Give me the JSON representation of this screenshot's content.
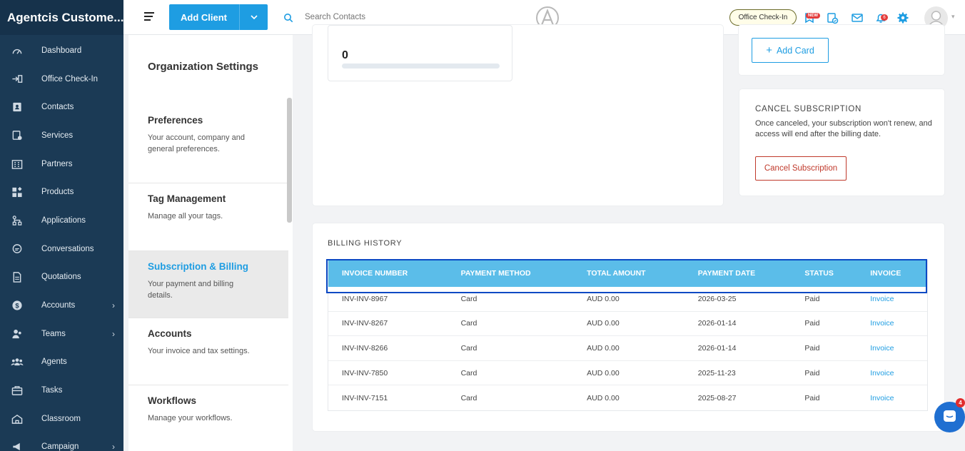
{
  "app": {
    "title": "Agentcis Custome..."
  },
  "sidebar": {
    "items": [
      {
        "label": "Dashboard",
        "icon": "speedometer-icon",
        "arrow": false
      },
      {
        "label": "Office Check-In",
        "icon": "checkin-icon",
        "arrow": false
      },
      {
        "label": "Contacts",
        "icon": "contacts-icon",
        "arrow": false
      },
      {
        "label": "Services",
        "icon": "services-icon",
        "arrow": false
      },
      {
        "label": "Partners",
        "icon": "building-icon",
        "arrow": false
      },
      {
        "label": "Products",
        "icon": "products-icon",
        "arrow": false
      },
      {
        "label": "Applications",
        "icon": "applications-icon",
        "arrow": false
      },
      {
        "label": "Conversations",
        "icon": "chat-icon",
        "arrow": false
      },
      {
        "label": "Quotations",
        "icon": "document-icon",
        "arrow": false
      },
      {
        "label": "Accounts",
        "icon": "dollar-icon",
        "arrow": true
      },
      {
        "label": "Teams",
        "icon": "team-icon",
        "arrow": true
      },
      {
        "label": "Agents",
        "icon": "agents-icon",
        "arrow": false
      },
      {
        "label": "Tasks",
        "icon": "briefcase-icon",
        "arrow": false
      },
      {
        "label": "Classroom",
        "icon": "classroom-icon",
        "arrow": false
      },
      {
        "label": "Campaign",
        "icon": "megaphone-icon",
        "arrow": true
      }
    ]
  },
  "topbar": {
    "add_client_label": "Add Client",
    "search_placeholder": "Search Contacts",
    "office_checkin_label": "Office Check-In",
    "new_badge": "NEW",
    "notification_count": "6"
  },
  "settings": {
    "title": "Organization Settings",
    "items": [
      {
        "title": "Preferences",
        "desc": "Your account, company and general preferences."
      },
      {
        "title": "Tag Management",
        "desc": "Manage all your tags."
      },
      {
        "title": "Subscription & Billing",
        "desc": "Your payment and billing details."
      },
      {
        "title": "Accounts",
        "desc": "Your invoice and tax settings."
      },
      {
        "title": "Workflows",
        "desc": "Manage your workflows."
      }
    ]
  },
  "license_card": {
    "value": "0"
  },
  "payment_card": {
    "add_card_label": "Add Card"
  },
  "cancel_card": {
    "title": "CANCEL SUBSCRIPTION",
    "description": "Once canceled, your subscription won't renew, and access will end after the billing date.",
    "button_label": "Cancel Subscription"
  },
  "billing": {
    "title": "BILLING HISTORY",
    "columns": [
      "INVOICE NUMBER",
      "PAYMENT METHOD",
      "TOTAL AMOUNT",
      "PAYMENT DATE",
      "STATUS",
      "INVOICE"
    ],
    "rows": [
      {
        "number": "INV-INV-8967",
        "method": "Card",
        "amount": "AUD 0.00",
        "date": "2026-03-25",
        "status": "Paid",
        "invoice": "Invoice"
      },
      {
        "number": "INV-INV-8267",
        "method": "Card",
        "amount": "AUD 0.00",
        "date": "2026-01-14",
        "status": "Paid",
        "invoice": "Invoice"
      },
      {
        "number": "INV-INV-8266",
        "method": "Card",
        "amount": "AUD 0.00",
        "date": "2026-01-14",
        "status": "Paid",
        "invoice": "Invoice"
      },
      {
        "number": "INV-INV-7850",
        "method": "Card",
        "amount": "AUD 0.00",
        "date": "2025-11-23",
        "status": "Paid",
        "invoice": "Invoice"
      },
      {
        "number": "INV-INV-7151",
        "method": "Card",
        "amount": "AUD 0.00",
        "date": "2025-08-27",
        "status": "Paid",
        "invoice": "Invoice"
      }
    ]
  },
  "chat": {
    "badge": "4"
  },
  "colors": {
    "sidebar": "#1b3a55",
    "accent": "#1e9de2",
    "table_header": "#5bbde9",
    "danger": "#c0392b"
  }
}
